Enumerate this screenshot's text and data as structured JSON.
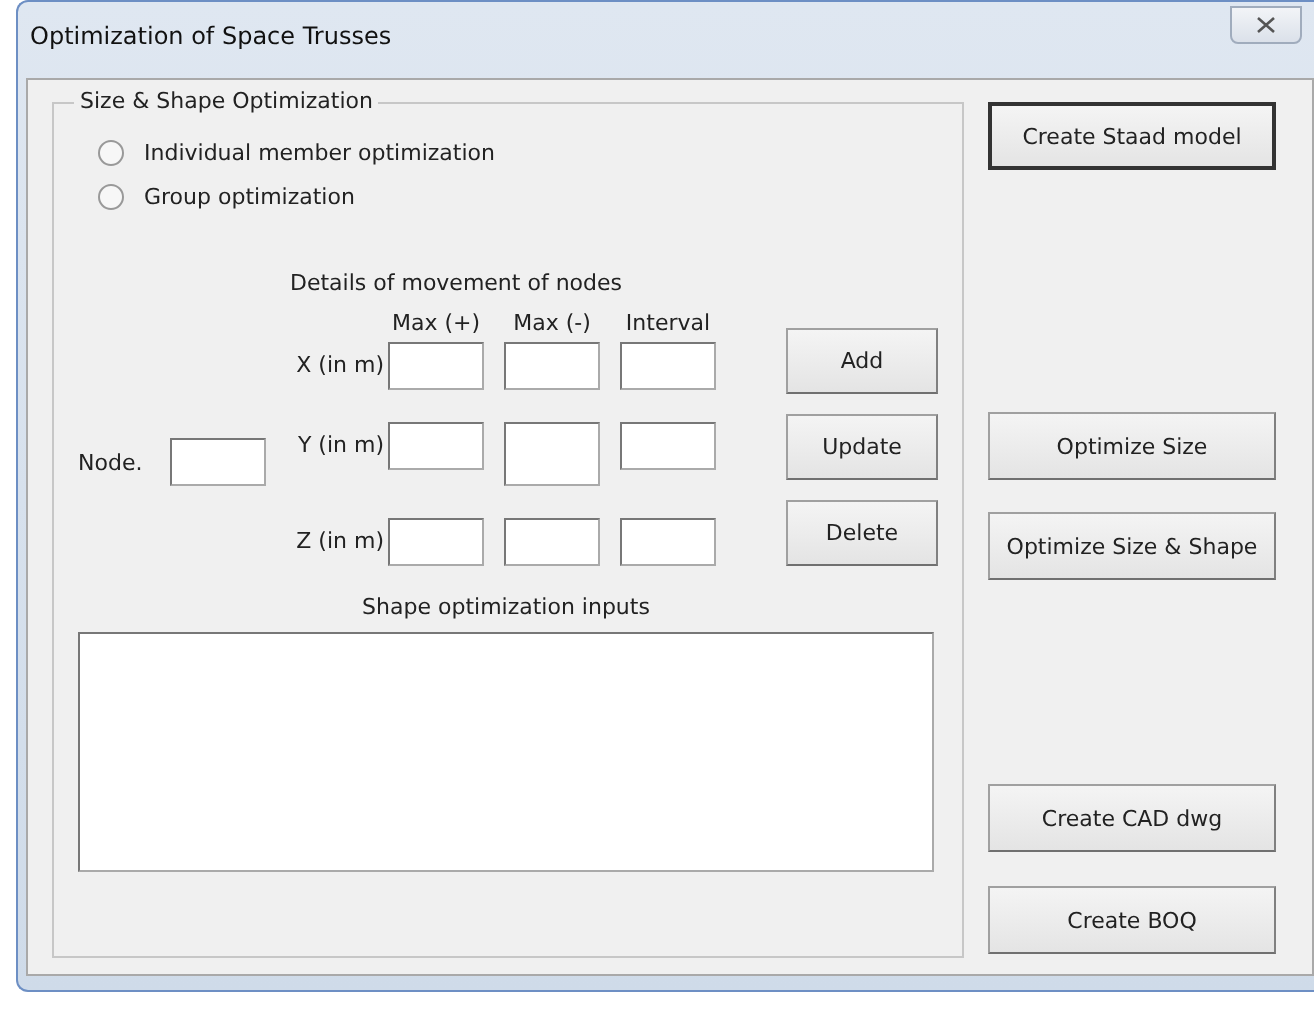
{
  "window": {
    "title": "Optimization of Space Trusses"
  },
  "group": {
    "legend": "Size & Shape Optimization",
    "options": [
      {
        "label": "Individual member optimization",
        "selected": false
      },
      {
        "label": "Group optimization",
        "selected": false
      }
    ],
    "movement": {
      "heading": "Details of movement of nodes",
      "columns": [
        "Max (+)",
        "Max (-)",
        "Interval"
      ],
      "node_label": "Node.",
      "rows": [
        "X (in m)",
        "Y (in m)",
        "Z (in m)"
      ],
      "buttons": [
        "Add",
        "Update",
        "Delete"
      ]
    },
    "shape_inputs": {
      "label": "Shape optimization inputs"
    }
  },
  "actions": [
    {
      "label": "Create Staad model",
      "default": true
    },
    {
      "label": "Optimize Size",
      "default": false
    },
    {
      "label": "Optimize Size & Shape",
      "default": false
    },
    {
      "label": "Create CAD dwg",
      "default": false
    },
    {
      "label": "Create BOQ",
      "default": false
    }
  ]
}
